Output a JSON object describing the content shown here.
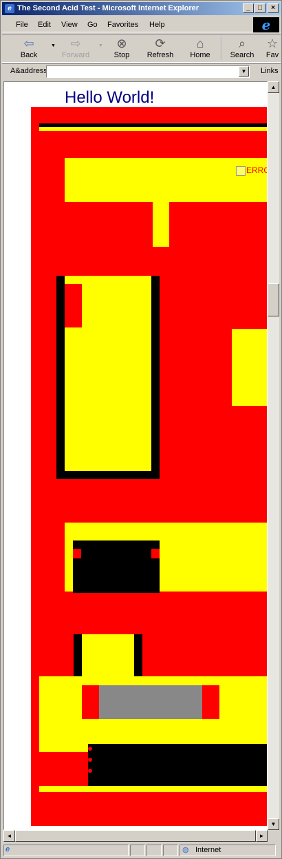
{
  "window": {
    "title": "The Second Acid Test - Microsoft Internet Explorer",
    "app_icon": "ie-page-icon"
  },
  "menu": {
    "file": "File",
    "edit": "Edit",
    "view": "View",
    "go": "Go",
    "favorites": "Favorites",
    "help": "Help"
  },
  "toolbar": {
    "back": "Back",
    "forward": "Forward",
    "stop": "Stop",
    "refresh": "Refresh",
    "home": "Home",
    "search": "Search",
    "favorites": "Fav"
  },
  "address": {
    "label": "A&address",
    "value": "",
    "links": "Links"
  },
  "page": {
    "heading": "Hello World!",
    "error_text": "ERRO"
  },
  "status": {
    "zone": "Internet"
  },
  "colors": {
    "red": "#ff0000",
    "yellow": "#ffff00",
    "black": "#000000",
    "gray": "#888888",
    "heading": "#000080"
  }
}
